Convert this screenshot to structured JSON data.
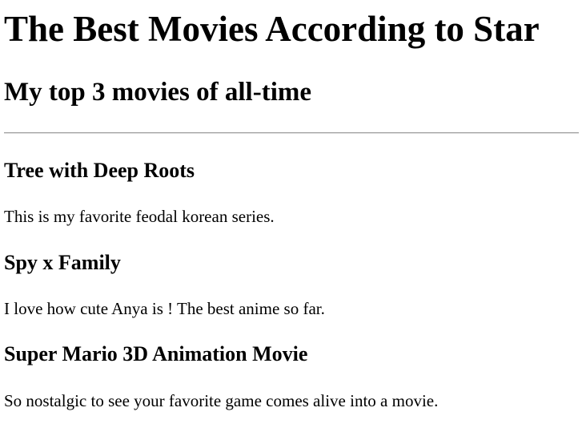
{
  "page": {
    "title": "The Best Movies According to Star",
    "subtitle": "My top 3 movies of all-time"
  },
  "movies": [
    {
      "title": "Tree with Deep Roots",
      "description": "This is my favorite feodal korean series."
    },
    {
      "title": "Spy x Family",
      "description": "I love how cute Anya is ! The best anime so far."
    },
    {
      "title": "Super Mario 3D Animation Movie",
      "description": "So nostalgic to see your favorite game comes alive into a movie."
    }
  ]
}
